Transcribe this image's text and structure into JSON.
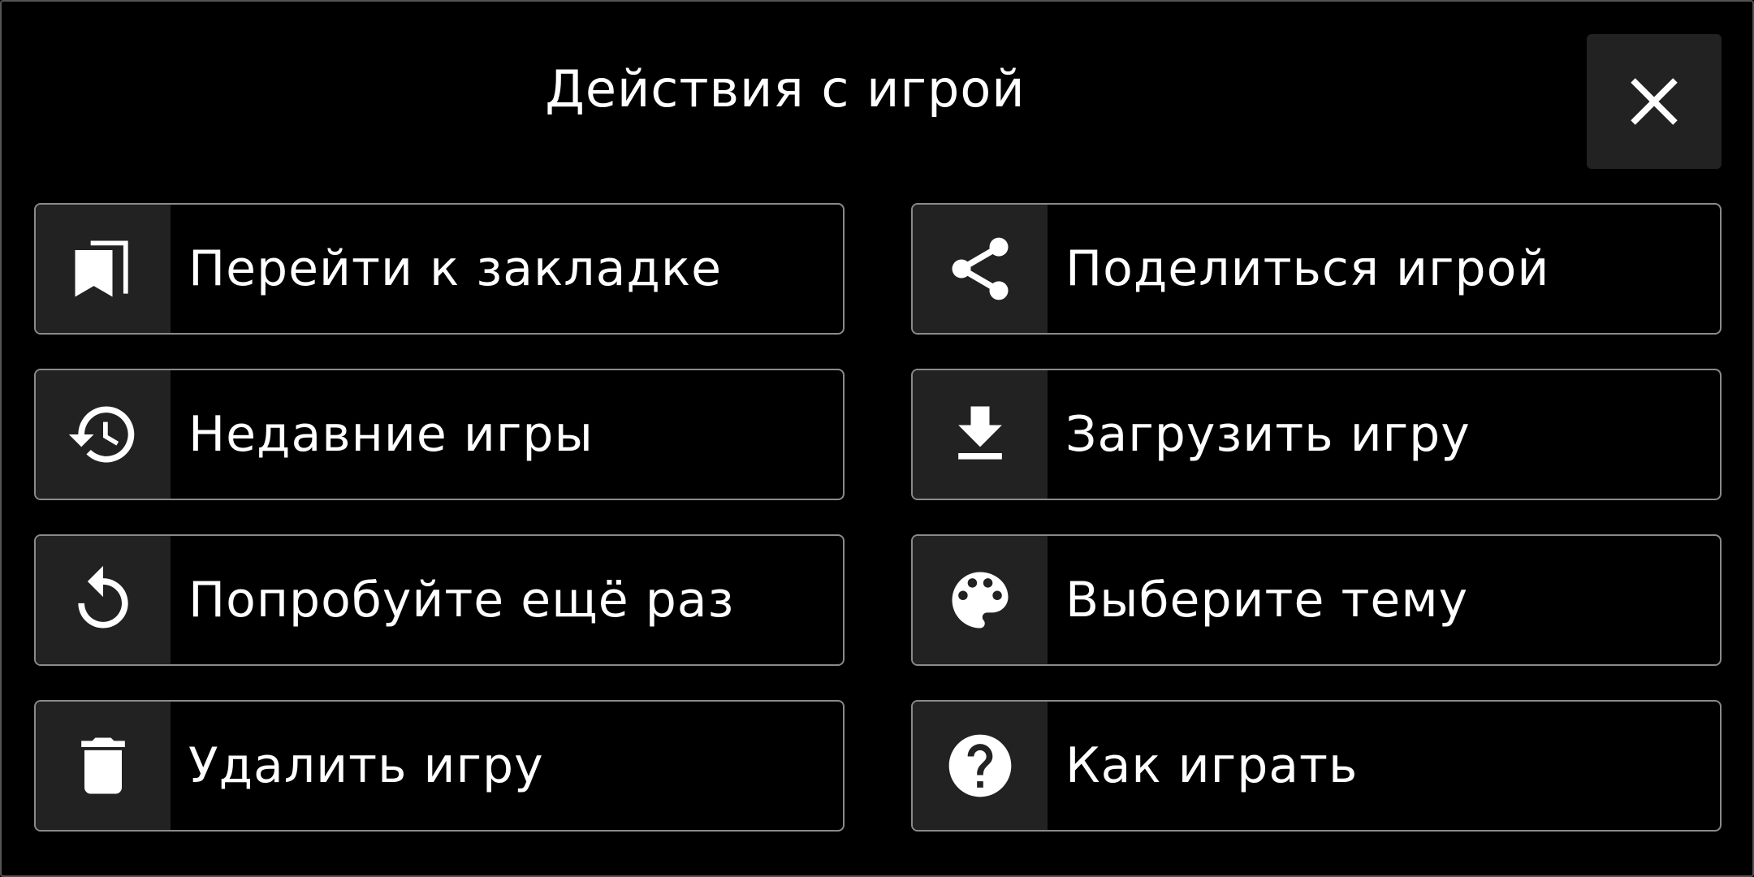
{
  "dialog": {
    "title": "Действия с игрой",
    "close_icon": "close-icon"
  },
  "actions": [
    {
      "id": "goto-bookmark",
      "label": "Перейти к закладке",
      "icon": "bookmarks-icon"
    },
    {
      "id": "share-game",
      "label": "Поделиться игрой",
      "icon": "share-icon"
    },
    {
      "id": "recent-games",
      "label": "Недавние игры",
      "icon": "history-icon"
    },
    {
      "id": "load-game",
      "label": "Загрузить игру",
      "icon": "download-icon"
    },
    {
      "id": "try-again",
      "label": "Попробуйте ещё раз",
      "icon": "restart-icon"
    },
    {
      "id": "choose-theme",
      "label": "Выберите тему",
      "icon": "palette-icon"
    },
    {
      "id": "delete-game",
      "label": "Удалить игру",
      "icon": "trash-icon"
    },
    {
      "id": "how-to-play",
      "label": "Как играть",
      "icon": "help-icon"
    }
  ],
  "colors": {
    "background": "#000000",
    "button_border": "#8a8a8a",
    "icon_panel": "#222222",
    "text": "#ffffff"
  }
}
